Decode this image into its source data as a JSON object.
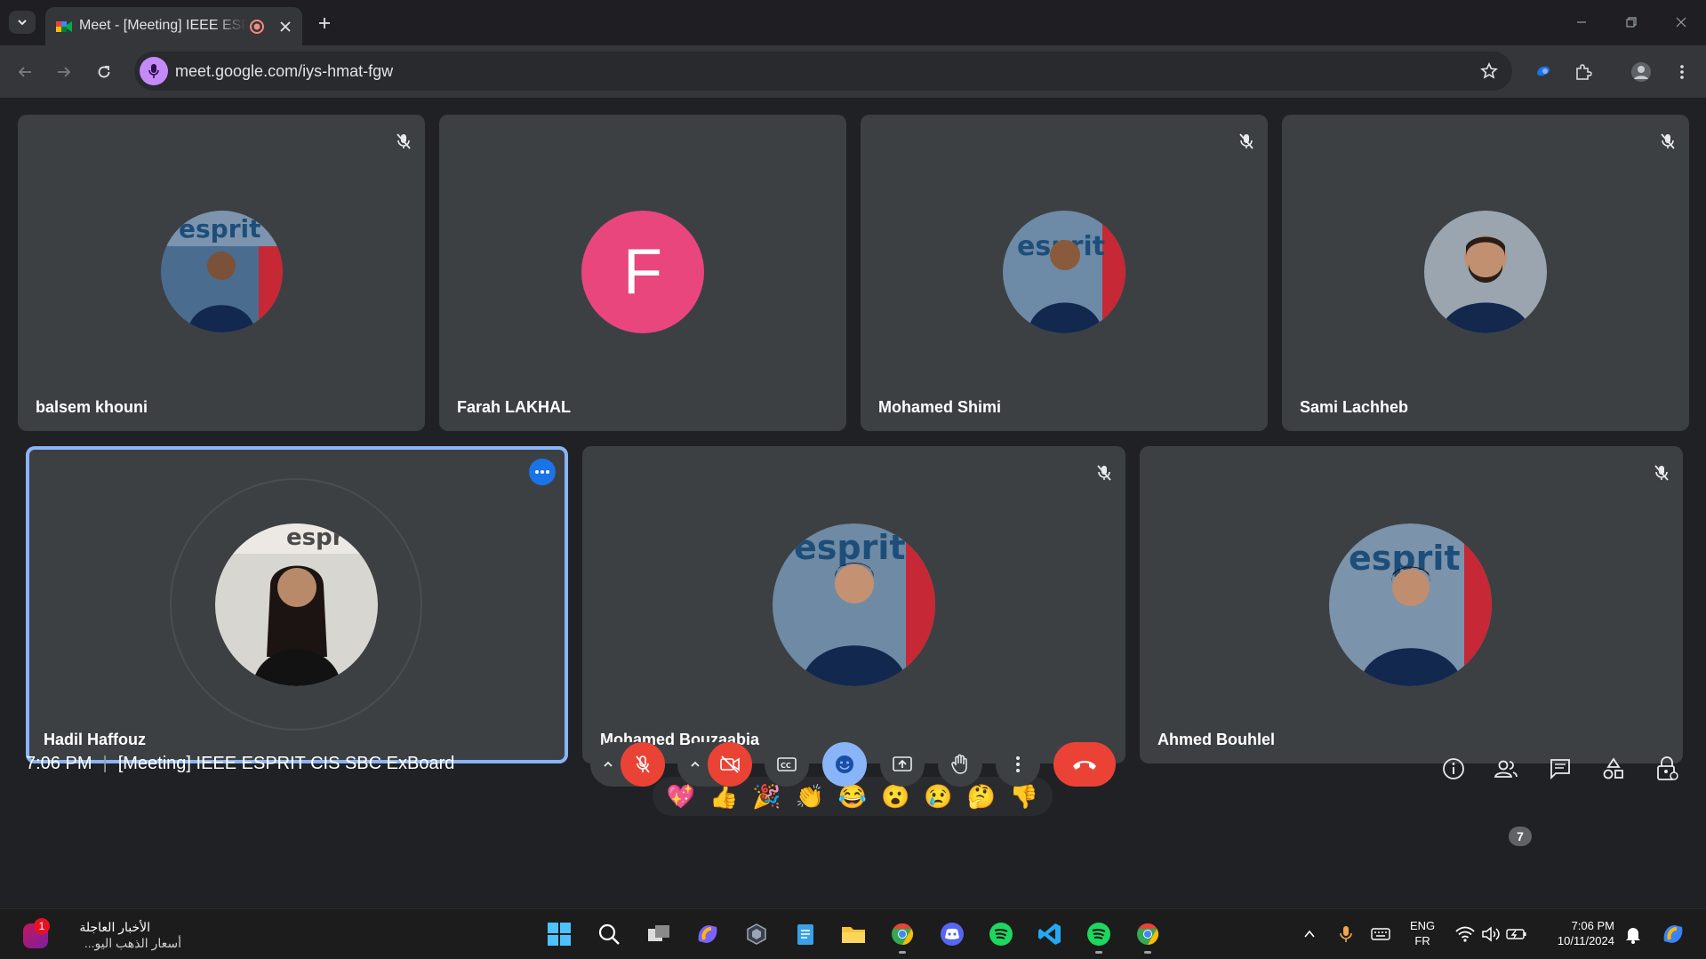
{
  "browser": {
    "tab_title": "Meet - [Meeting] IEEE ESPRIT CIS SBC ExBoard",
    "url": "meet.google.com/iys-hmat-fgw"
  },
  "participants": [
    {
      "name": "balsem khouni",
      "muted": true,
      "avatar": "photo"
    },
    {
      "name": "Farah LAKHAL",
      "muted": false,
      "avatar": "initial",
      "initial": "F",
      "color": "#e8467c"
    },
    {
      "name": "Mohamed Shimi",
      "muted": true,
      "avatar": "photo"
    },
    {
      "name": "Sami Lachheb",
      "muted": true,
      "avatar": "photo"
    },
    {
      "name": "Hadil Haffouz",
      "muted": false,
      "avatar": "photo",
      "speaking": true
    },
    {
      "name": "Mohamed Bouzaabia",
      "muted": true,
      "avatar": "photo"
    },
    {
      "name": "Ahmed Bouhlel",
      "muted": true,
      "avatar": "photo"
    }
  ],
  "reactions": [
    "💖",
    "👍",
    "🎉",
    "👏",
    "😂",
    "😮",
    "😢",
    "🤔",
    "👎"
  ],
  "meeting": {
    "time": "7:06 PM",
    "separator": "|",
    "title": "[Meeting] IEEE ESPRIT CIS SBC ExBoard",
    "people_count": "7"
  },
  "colors": {
    "accent_blue": "#8ab4f8",
    "danger_red": "#ea4335",
    "tile_bg": "#3c4043",
    "stage_bg": "#202124"
  },
  "taskbar": {
    "news_badge": "1",
    "news_title": "الأخبار العاجلة",
    "news_subtitle": "أسعار الذهب اليو...",
    "lang_primary": "ENG",
    "lang_secondary": "FR",
    "clock_time": "7:06 PM",
    "clock_date": "10/11/2024"
  }
}
